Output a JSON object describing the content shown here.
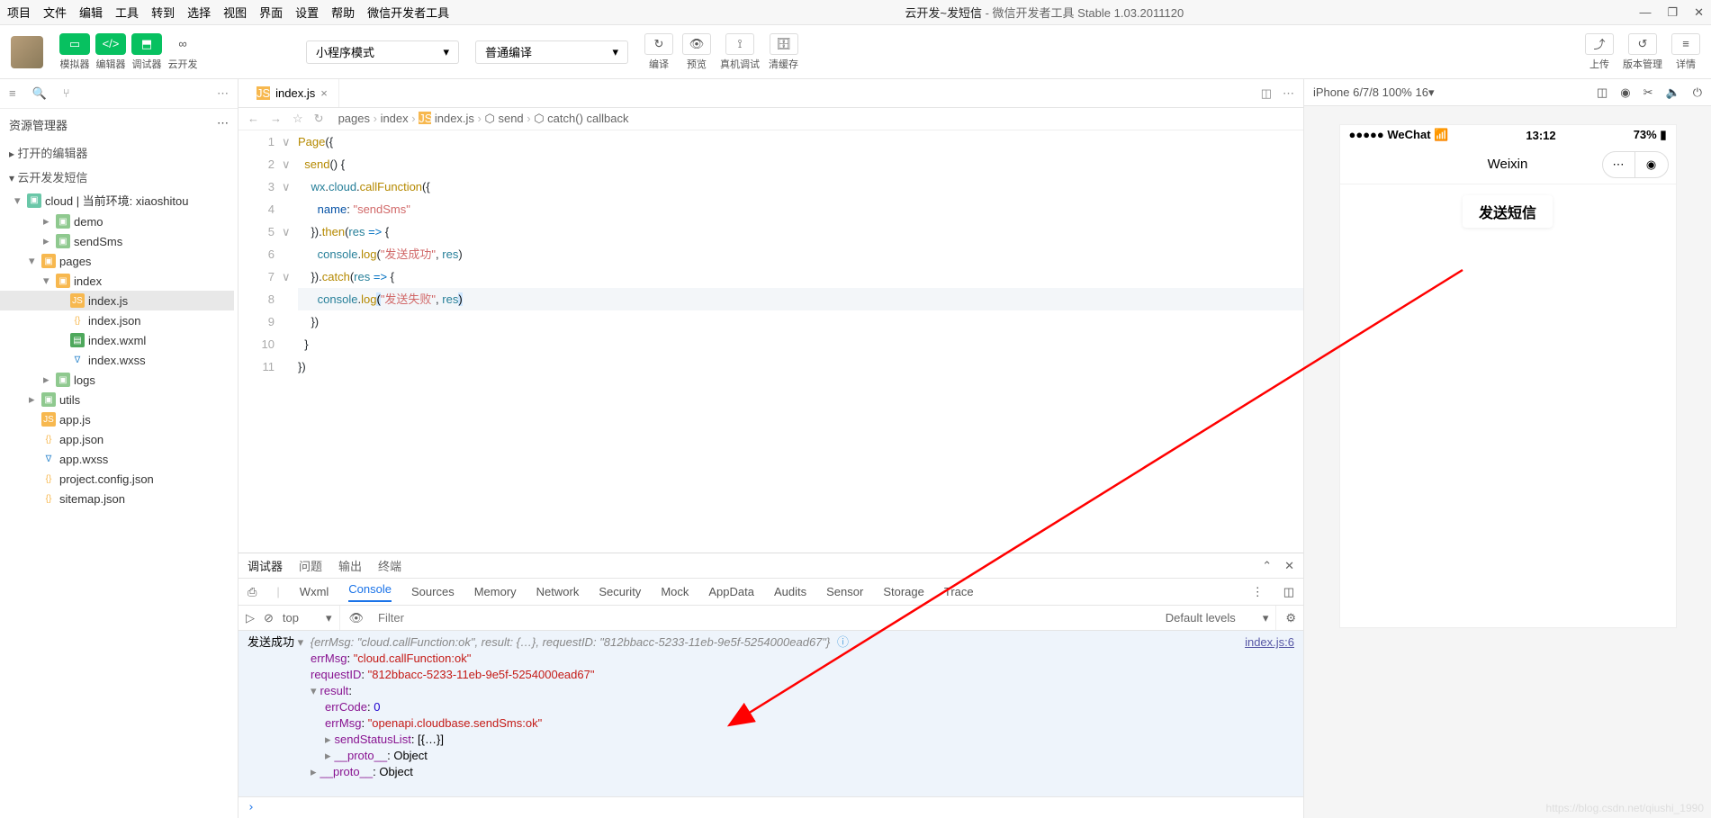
{
  "menu": {
    "items": [
      "项目",
      "文件",
      "编辑",
      "工具",
      "转到",
      "选择",
      "视图",
      "界面",
      "设置",
      "帮助",
      "微信开发者工具"
    ],
    "title_main": "云开发~发短信",
    "title_sub": "微信开发者工具 Stable 1.03.2011120"
  },
  "toolbar": {
    "simulator": "模拟器",
    "editor": "编辑器",
    "debugger": "调试器",
    "cloud": "云开发",
    "mode": "小程序模式",
    "compile_mode": "普通编译",
    "compile": "编译",
    "preview": "预览",
    "remote": "真机调试",
    "clear_cache": "清缓存",
    "upload": "上传",
    "version": "版本管理",
    "detail": "详情"
  },
  "sidebar": {
    "header": "资源管理器",
    "open": "打开的编辑器",
    "project": "云开发发短信",
    "cloud": "cloud | 当前环境: xiaoshitou",
    "tree": [
      {
        "l": "demo",
        "d": 1,
        "ic": "folder",
        "interact": true
      },
      {
        "l": "sendSms",
        "d": 1,
        "ic": "folder",
        "interact": true
      },
      {
        "l": "pages",
        "d": 0,
        "ic": "folder-pages",
        "exp": true,
        "interact": true
      },
      {
        "l": "index",
        "d": 1,
        "ic": "folder-pages",
        "exp": true,
        "interact": true
      },
      {
        "l": "index.js",
        "d": 2,
        "ic": "js",
        "sel": true,
        "interact": true
      },
      {
        "l": "index.json",
        "d": 2,
        "ic": "json",
        "interact": true
      },
      {
        "l": "index.wxml",
        "d": 2,
        "ic": "wxml",
        "interact": true
      },
      {
        "l": "index.wxss",
        "d": 2,
        "ic": "wxss",
        "interact": true
      },
      {
        "l": "logs",
        "d": 1,
        "ic": "folder",
        "interact": true
      },
      {
        "l": "utils",
        "d": 0,
        "ic": "folder",
        "interact": true
      },
      {
        "l": "app.js",
        "d": 0,
        "ic": "js",
        "interact": true
      },
      {
        "l": "app.json",
        "d": 0,
        "ic": "json",
        "interact": true
      },
      {
        "l": "app.wxss",
        "d": 0,
        "ic": "wxss",
        "interact": true
      },
      {
        "l": "project.config.json",
        "d": 0,
        "ic": "json",
        "interact": true
      },
      {
        "l": "sitemap.json",
        "d": 0,
        "ic": "json",
        "interact": true
      }
    ]
  },
  "tab": {
    "name": "index.js"
  },
  "breadcrumb": [
    "pages",
    "index",
    "index.js",
    "send",
    "catch() callback"
  ],
  "code": {
    "lines": [
      {
        "n": 1,
        "fold": "∨",
        "html": "<span class='tok-fn'>Page</span><span class='tok-punc'>({</span>"
      },
      {
        "n": 2,
        "fold": "∨",
        "html": "  <span class='tok-fn'>send</span><span class='tok-punc'>() {</span>"
      },
      {
        "n": 3,
        "fold": "∨",
        "html": "    <span class='tok-id'>wx</span><span class='tok-punc'>.</span><span class='tok-id'>cloud</span><span class='tok-punc'>.</span><span class='tok-fn'>callFunction</span><span class='tok-punc'>({</span>"
      },
      {
        "n": 4,
        "fold": "",
        "html": "      <span class='tok-prop'>name</span><span class='tok-punc'>:</span> <span class='tok-str'>\"sendSms\"</span>"
      },
      {
        "n": 5,
        "fold": "∨",
        "html": "    <span class='tok-punc'>}).</span><span class='tok-fn'>then</span><span class='tok-punc'>(</span><span class='tok-id'>res</span> <span class='tok-kw'>=></span> <span class='tok-punc'>{</span>"
      },
      {
        "n": 6,
        "fold": "",
        "html": "      <span class='tok-id'>console</span><span class='tok-punc'>.</span><span class='tok-fn'>log</span><span class='tok-punc'>(</span><span class='tok-str'>\"发送成功\"</span><span class='tok-punc'>,</span> <span class='tok-id'>res</span><span class='tok-punc'>)</span>"
      },
      {
        "n": 7,
        "fold": "∨",
        "html": "    <span class='tok-punc'>}).</span><span class='tok-fn'>catch</span><span class='tok-punc'>(</span><span class='tok-id'>res</span> <span class='tok-kw'>=></span> <span class='tok-punc'>{</span>"
      },
      {
        "n": 8,
        "fold": "",
        "hl": true,
        "html": "      <span class='tok-id'>console</span><span class='tok-punc'>.</span><span class='tok-fn'>log</span><span class='tok-sel'>(</span><span class='tok-str'>\"发送失败\"</span><span class='tok-punc'>,</span> <span class='tok-id'>res</span><span class='tok-sel'>)</span>"
      },
      {
        "n": 9,
        "fold": "",
        "html": "    <span class='tok-punc'>})</span>"
      },
      {
        "n": 10,
        "fold": "",
        "html": "  <span class='tok-punc'>}</span>"
      },
      {
        "n": 11,
        "fold": "",
        "html": "<span class='tok-punc'>})</span>"
      }
    ]
  },
  "debug": {
    "tabs": [
      "调试器",
      "问题",
      "输出",
      "终端"
    ],
    "devtabs": [
      "Wxml",
      "Console",
      "Sources",
      "Memory",
      "Network",
      "Security",
      "Mock",
      "AppData",
      "Audits",
      "Sensor",
      "Storage",
      "Trace"
    ],
    "context": "top",
    "filter_ph": "Filter",
    "levels": "Default levels",
    "link": "index.js:6",
    "log_prefix": "发送成功",
    "summary": "{errMsg: \"cloud.callFunction:ok\", result: {…}, requestID: \"812bbacc-5233-11eb-9e5f-5254000ead67\"}",
    "rows": [
      {
        "k": "errMsg",
        "v": "\"cloud.callFunction:ok\"",
        "t": "str"
      },
      {
        "k": "requestID",
        "v": "\"812bbacc-5233-11eb-9e5f-5254000ead67\"",
        "t": "str"
      },
      {
        "k": "result",
        "v": "",
        "t": "exp"
      },
      {
        "k": "errCode",
        "v": "0",
        "t": "num",
        "ind": 1
      },
      {
        "k": "errMsg",
        "v": "\"openapi.cloudbase.sendSms:ok\"",
        "t": "str",
        "ind": 1
      },
      {
        "k": "sendStatusList",
        "v": "[{…}]",
        "t": "obj",
        "ind": 1,
        "arr": true
      },
      {
        "k": "__proto__",
        "v": "Object",
        "t": "obj",
        "ind": 1,
        "arr": true
      },
      {
        "k": "__proto__",
        "v": "Object",
        "t": "obj",
        "arr": true
      }
    ]
  },
  "sim": {
    "device": "iPhone 6/7/8 100% 16",
    "carrier": "WeChat",
    "time": "13:12",
    "battery": "73%",
    "page_title": "Weixin",
    "button": "发送短信"
  },
  "watermark": "https://blog.csdn.net/qiushi_1990"
}
